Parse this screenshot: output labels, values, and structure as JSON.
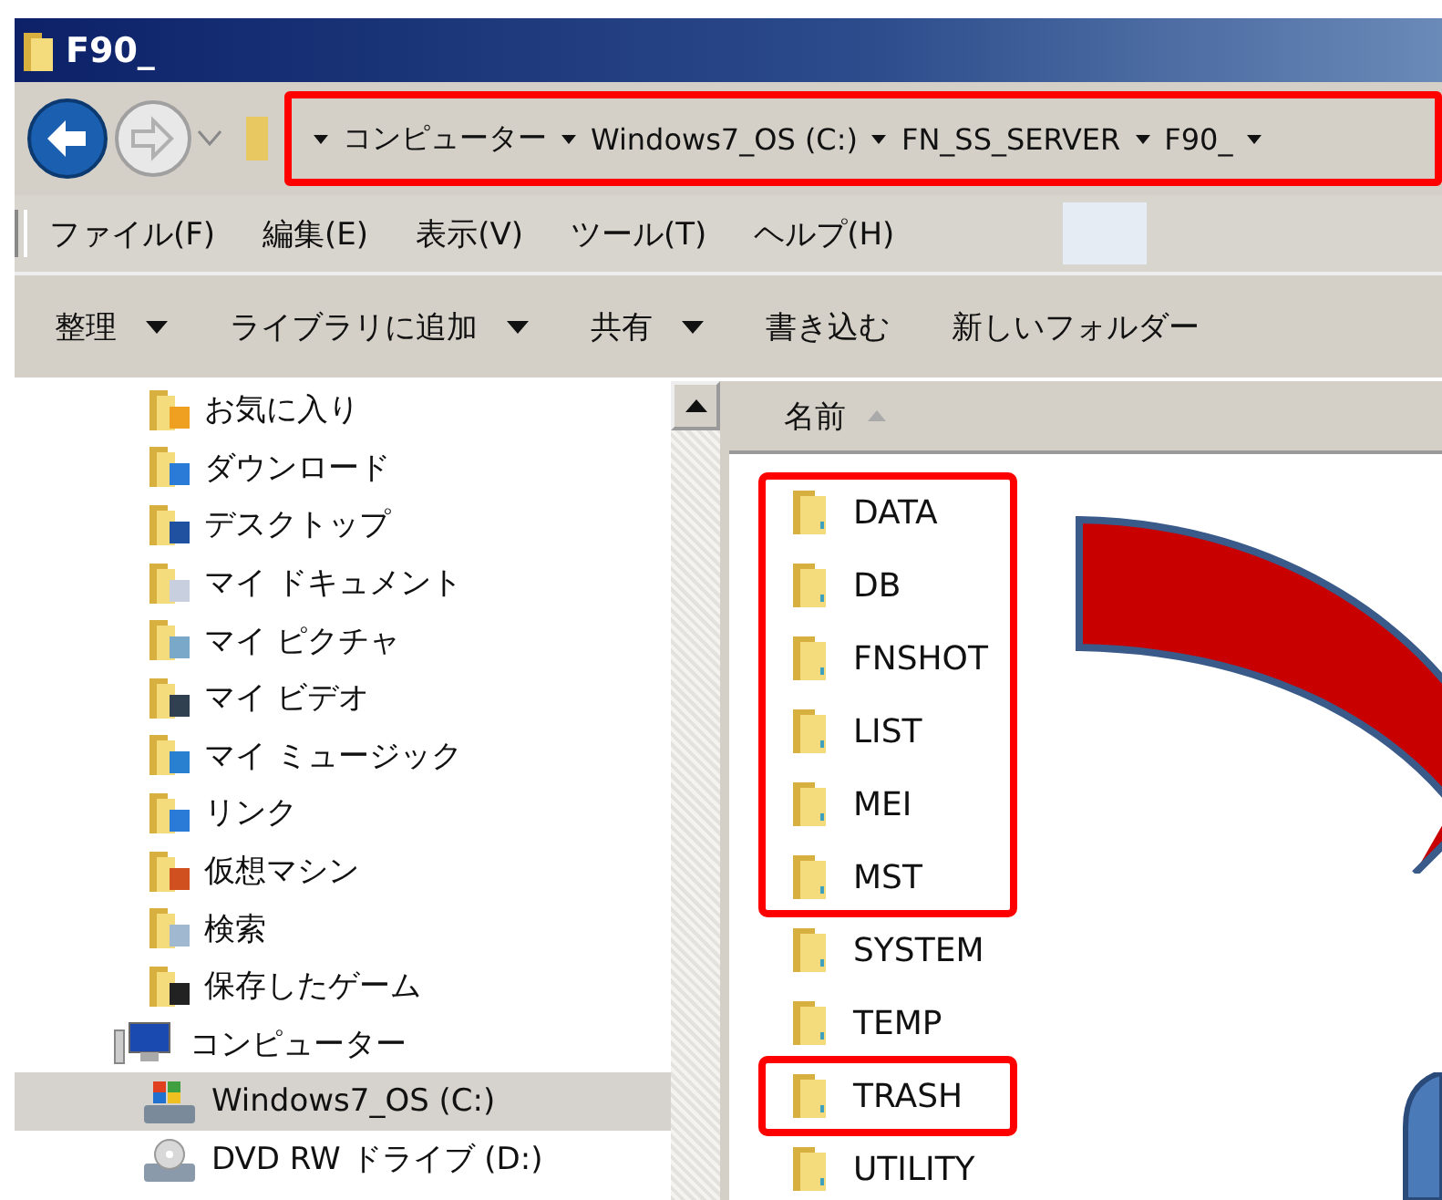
{
  "window": {
    "title": "F90_"
  },
  "address_bar": {
    "highlighted": true,
    "segments": [
      "コンピューター",
      "Windows7_OS (C:)",
      "FN_SS_SERVER",
      "F90_"
    ]
  },
  "menu": [
    "ファイル(F)",
    "編集(E)",
    "表示(V)",
    "ツール(T)",
    "ヘルプ(H)"
  ],
  "toolbar": [
    {
      "label": "整理",
      "dropdown": true
    },
    {
      "label": "ライブラリに追加",
      "dropdown": true
    },
    {
      "label": "共有",
      "dropdown": true
    },
    {
      "label": "書き込む",
      "dropdown": false
    },
    {
      "label": "新しいフォルダー",
      "dropdown": false
    }
  ],
  "sidebar": {
    "items": [
      {
        "label": "お気に入り",
        "kind": "favorites",
        "selected": false
      },
      {
        "label": "ダウンロード",
        "kind": "downloads",
        "selected": false
      },
      {
        "label": "デスクトップ",
        "kind": "desktop",
        "selected": false
      },
      {
        "label": "マイ ドキュメント",
        "kind": "documents",
        "selected": false
      },
      {
        "label": "マイ ピクチャ",
        "kind": "pictures",
        "selected": false
      },
      {
        "label": "マイ ビデオ",
        "kind": "videos",
        "selected": false
      },
      {
        "label": "マイ ミュージック",
        "kind": "music",
        "selected": false
      },
      {
        "label": "リンク",
        "kind": "links",
        "selected": false
      },
      {
        "label": "仮想マシン",
        "kind": "vm",
        "selected": false
      },
      {
        "label": "検索",
        "kind": "search",
        "selected": false
      },
      {
        "label": "保存したゲーム",
        "kind": "games",
        "selected": false
      },
      {
        "label": "コンピューター",
        "kind": "computer",
        "selected": false,
        "children": [
          {
            "label": "Windows7_OS (C:)",
            "kind": "drive",
            "selected": true
          },
          {
            "label": "DVD RW ドライブ (D:)",
            "kind": "dvd",
            "selected": false
          }
        ]
      }
    ]
  },
  "file_list": {
    "column": "名前",
    "groups": [
      {
        "highlighted": true,
        "items": [
          "DATA",
          "DB",
          "FNSHOT",
          "LIST",
          "MEI",
          "MST"
        ]
      },
      {
        "highlighted": false,
        "items": [
          "SYSTEM",
          "TEMP"
        ]
      },
      {
        "highlighted": true,
        "items": [
          "TRASH"
        ]
      },
      {
        "highlighted": false,
        "items": [
          "UTILITY"
        ]
      }
    ]
  }
}
